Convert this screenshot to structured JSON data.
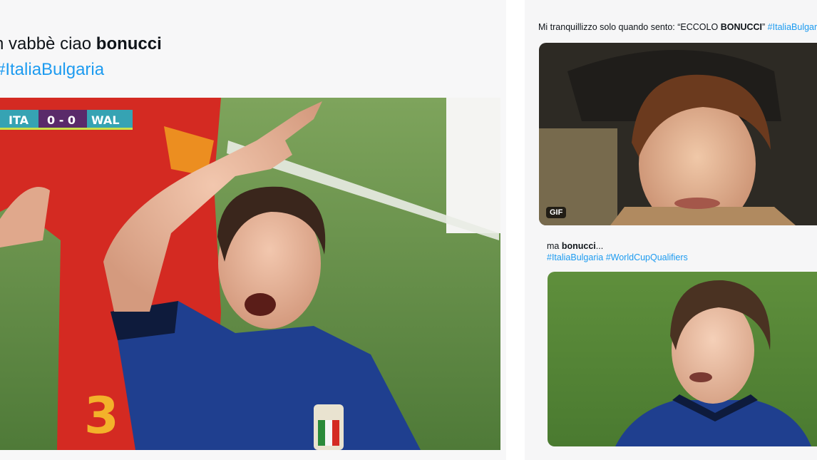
{
  "left_tweet": {
    "text_prefix": "n vabbè ciao ",
    "text_bold": "bonucci",
    "hashtag": "#ItaliaBulgaria",
    "scoreboard": {
      "home": "ITA",
      "score": "0 - 0",
      "away": "WAL"
    },
    "shirt_number": "3"
  },
  "right_tweet_1": {
    "text_prefix": "Mi tranquillizzo solo quando sento: “ECCOLO ",
    "text_bold": "BONUCCI",
    "text_suffix": "” ",
    "hashtag": "#ItaliaBulgaria",
    "badge": "GIF"
  },
  "right_tweet_2": {
    "text_prefix": "ma ",
    "text_bold": "bonucci",
    "text_suffix": "...",
    "hashtags": [
      "#ItaliaBulgaria",
      "#WorldCupQualifiers"
    ]
  },
  "colors": {
    "hashtag": "#1d9bf0",
    "text": "#0f1419",
    "pitch": "#5f8a45",
    "italy_blue": "#1f3f8f",
    "wales_red": "#d42a22"
  }
}
